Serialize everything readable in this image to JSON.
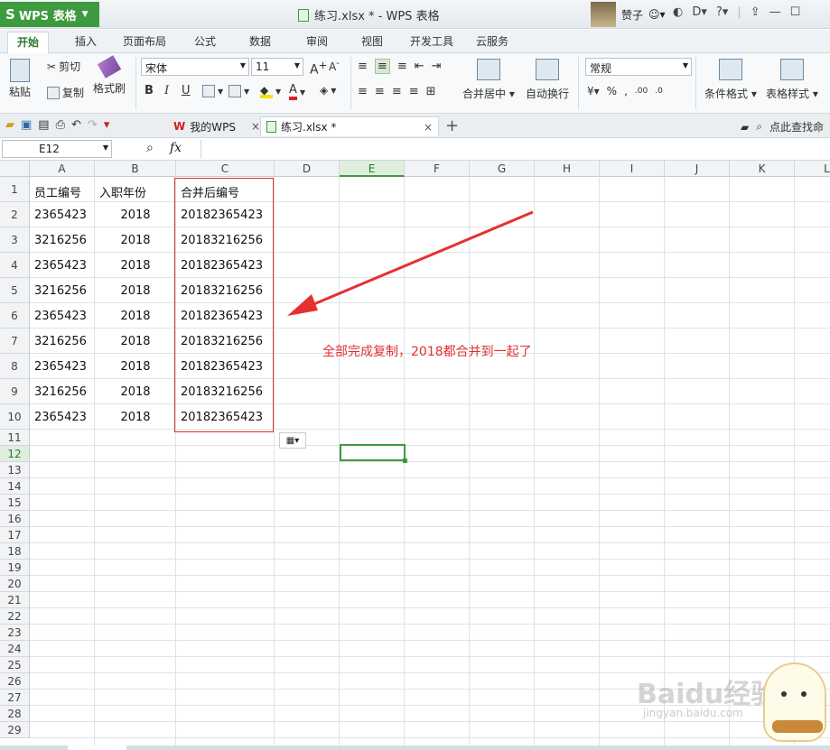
{
  "app": {
    "title": "WPS 表格",
    "window_title": "练习.xlsx * - WPS 表格"
  },
  "user": {
    "name": "赞子"
  },
  "menu": [
    "开始",
    "插入",
    "页面布局",
    "公式",
    "数据",
    "审阅",
    "视图",
    "开发工具",
    "云服务"
  ],
  "ribbon": {
    "paste": "粘贴",
    "cut": "剪切",
    "copy": "复制",
    "format_painter": "格式刷",
    "font_name": "宋体",
    "font_size": "11",
    "merge_center": "合并居中",
    "wrap_text": "自动换行",
    "number_format": "常规",
    "conditional_format": "条件格式",
    "table_style": "表格样式"
  },
  "doc_tabs": {
    "home": "我的WPS",
    "file": "练习.xlsx *",
    "search": "点此查找命"
  },
  "formula_bar": {
    "cell_ref": "E12",
    "fx": "fx"
  },
  "columns": [
    "A",
    "B",
    "C",
    "D",
    "E",
    "F",
    "G",
    "H",
    "I",
    "J",
    "K",
    "L"
  ],
  "rows": [
    "1",
    "2",
    "3",
    "4",
    "5",
    "6",
    "7",
    "8",
    "9",
    "10",
    "11",
    "12",
    "13",
    "14",
    "15",
    "16",
    "17",
    "18",
    "19",
    "20",
    "21",
    "22",
    "23",
    "24",
    "25",
    "26",
    "27",
    "28",
    "29"
  ],
  "table": {
    "headers": [
      "员工编号",
      "入职年份",
      "合并后编号"
    ],
    "rows": [
      [
        "2365423",
        "2018",
        "20182365423"
      ],
      [
        "3216256",
        "2018",
        "20183216256"
      ],
      [
        "2365423",
        "2018",
        "20182365423"
      ],
      [
        "3216256",
        "2018",
        "20183216256"
      ],
      [
        "2365423",
        "2018",
        "20182365423"
      ],
      [
        "3216256",
        "2018",
        "20183216256"
      ],
      [
        "2365423",
        "2018",
        "20182365423"
      ],
      [
        "3216256",
        "2018",
        "20183216256"
      ],
      [
        "2365423",
        "2018",
        "20182365423"
      ]
    ]
  },
  "annotation": {
    "text": "全部完成复制，2018都合并到一起了",
    "color": "#e03030"
  },
  "watermark": {
    "text": "Baidu经验",
    "subtext": "jingyan.baidu.com"
  },
  "colors": {
    "accent": "#3e9a3e",
    "highlight_border": "#e03030"
  }
}
